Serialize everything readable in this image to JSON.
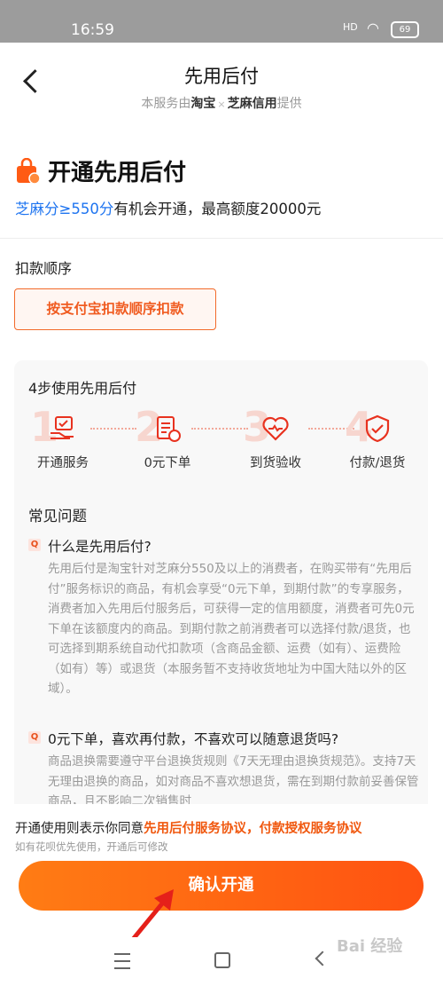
{
  "status_bar": {
    "time": "16:59",
    "signal": "HD",
    "battery": "69"
  },
  "header": {
    "title": "先用后付",
    "subtitle_prefix": "本服务由",
    "provider1": "淘宝",
    "separator": "×",
    "provider2": "芝麻信用",
    "subtitle_suffix": "提供"
  },
  "intro": {
    "title": "开通先用后付",
    "zhima_highlight": "芝麻分≥550分",
    "zhima_rest": "有机会开通，最高额度20000元"
  },
  "payment_order": {
    "label": "扣款顺序",
    "button": "按支付宝扣款顺序扣款"
  },
  "steps": {
    "title": "4步使用先用后付",
    "items": [
      {
        "num": "1",
        "label": "开通服务",
        "icon": "hand-card-icon"
      },
      {
        "num": "2",
        "label": "0元下单",
        "icon": "order-icon"
      },
      {
        "num": "3",
        "label": "到货验收",
        "icon": "heart-icon"
      },
      {
        "num": "4",
        "label": "付款/退货",
        "icon": "shield-check-icon"
      }
    ]
  },
  "faq": {
    "title": "常见问题",
    "badge": "Q",
    "items": [
      {
        "question": "什么是先用后付?",
        "answer": "先用后付是淘宝针对芝麻分550及以上的消费者，在购买带有“先用后付”服务标识的商品，有机会享受“0元下单，到期付款”的专享服务，消费者加入先用后付服务后，可获得一定的信用额度，消费者可先0元下单在该额度内的商品。到期付款之前消费者可以选择付款/退货，也可选择到期系统自动代扣款项（含商品金额、运费（如有）、运费险（如有）等）或退货（本服务暂不支持收货地址为中国大陆以外的区域）。"
      },
      {
        "question": "0元下单，喜欢再付款，不喜欢可以随意退货吗?",
        "answer": "商品退换需要遵守平台退换货规则《7天无理由退换货规范》。支持7天无理由退换的商品，如对商品不喜欢想退货，需在到期付款前妥善保管商品，且不影响二次销售时"
      }
    ]
  },
  "agreement": {
    "prefix": "开通使用则表示你同意",
    "link1": "先用后付服务协议",
    "comma": "，",
    "link2": "付款授权服务协议",
    "hint": "如有花呗优先使用，开通后可修改"
  },
  "confirm_button": "确认开通",
  "watermark": "Bai 经验",
  "colors": {
    "accent": "#ff6512",
    "link_blue": "#1e74f0"
  }
}
